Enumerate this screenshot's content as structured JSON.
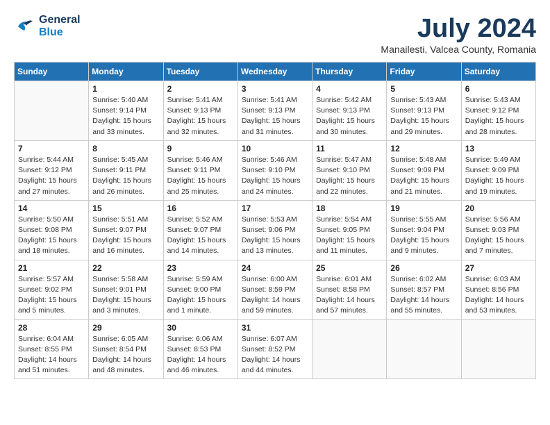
{
  "header": {
    "logo_line1": "General",
    "logo_line2": "Blue",
    "month_title": "July 2024",
    "location": "Manailesti, Valcea County, Romania"
  },
  "days_of_week": [
    "Sunday",
    "Monday",
    "Tuesday",
    "Wednesday",
    "Thursday",
    "Friday",
    "Saturday"
  ],
  "weeks": [
    [
      {
        "day": "",
        "data": ""
      },
      {
        "day": "1",
        "data": "Sunrise: 5:40 AM\nSunset: 9:14 PM\nDaylight: 15 hours\nand 33 minutes."
      },
      {
        "day": "2",
        "data": "Sunrise: 5:41 AM\nSunset: 9:13 PM\nDaylight: 15 hours\nand 32 minutes."
      },
      {
        "day": "3",
        "data": "Sunrise: 5:41 AM\nSunset: 9:13 PM\nDaylight: 15 hours\nand 31 minutes."
      },
      {
        "day": "4",
        "data": "Sunrise: 5:42 AM\nSunset: 9:13 PM\nDaylight: 15 hours\nand 30 minutes."
      },
      {
        "day": "5",
        "data": "Sunrise: 5:43 AM\nSunset: 9:13 PM\nDaylight: 15 hours\nand 29 minutes."
      },
      {
        "day": "6",
        "data": "Sunrise: 5:43 AM\nSunset: 9:12 PM\nDaylight: 15 hours\nand 28 minutes."
      }
    ],
    [
      {
        "day": "7",
        "data": "Sunrise: 5:44 AM\nSunset: 9:12 PM\nDaylight: 15 hours\nand 27 minutes."
      },
      {
        "day": "8",
        "data": "Sunrise: 5:45 AM\nSunset: 9:11 PM\nDaylight: 15 hours\nand 26 minutes."
      },
      {
        "day": "9",
        "data": "Sunrise: 5:46 AM\nSunset: 9:11 PM\nDaylight: 15 hours\nand 25 minutes."
      },
      {
        "day": "10",
        "data": "Sunrise: 5:46 AM\nSunset: 9:10 PM\nDaylight: 15 hours\nand 24 minutes."
      },
      {
        "day": "11",
        "data": "Sunrise: 5:47 AM\nSunset: 9:10 PM\nDaylight: 15 hours\nand 22 minutes."
      },
      {
        "day": "12",
        "data": "Sunrise: 5:48 AM\nSunset: 9:09 PM\nDaylight: 15 hours\nand 21 minutes."
      },
      {
        "day": "13",
        "data": "Sunrise: 5:49 AM\nSunset: 9:09 PM\nDaylight: 15 hours\nand 19 minutes."
      }
    ],
    [
      {
        "day": "14",
        "data": "Sunrise: 5:50 AM\nSunset: 9:08 PM\nDaylight: 15 hours\nand 18 minutes."
      },
      {
        "day": "15",
        "data": "Sunrise: 5:51 AM\nSunset: 9:07 PM\nDaylight: 15 hours\nand 16 minutes."
      },
      {
        "day": "16",
        "data": "Sunrise: 5:52 AM\nSunset: 9:07 PM\nDaylight: 15 hours\nand 14 minutes."
      },
      {
        "day": "17",
        "data": "Sunrise: 5:53 AM\nSunset: 9:06 PM\nDaylight: 15 hours\nand 13 minutes."
      },
      {
        "day": "18",
        "data": "Sunrise: 5:54 AM\nSunset: 9:05 PM\nDaylight: 15 hours\nand 11 minutes."
      },
      {
        "day": "19",
        "data": "Sunrise: 5:55 AM\nSunset: 9:04 PM\nDaylight: 15 hours\nand 9 minutes."
      },
      {
        "day": "20",
        "data": "Sunrise: 5:56 AM\nSunset: 9:03 PM\nDaylight: 15 hours\nand 7 minutes."
      }
    ],
    [
      {
        "day": "21",
        "data": "Sunrise: 5:57 AM\nSunset: 9:02 PM\nDaylight: 15 hours\nand 5 minutes."
      },
      {
        "day": "22",
        "data": "Sunrise: 5:58 AM\nSunset: 9:01 PM\nDaylight: 15 hours\nand 3 minutes."
      },
      {
        "day": "23",
        "data": "Sunrise: 5:59 AM\nSunset: 9:00 PM\nDaylight: 15 hours\nand 1 minute."
      },
      {
        "day": "24",
        "data": "Sunrise: 6:00 AM\nSunset: 8:59 PM\nDaylight: 14 hours\nand 59 minutes."
      },
      {
        "day": "25",
        "data": "Sunrise: 6:01 AM\nSunset: 8:58 PM\nDaylight: 14 hours\nand 57 minutes."
      },
      {
        "day": "26",
        "data": "Sunrise: 6:02 AM\nSunset: 8:57 PM\nDaylight: 14 hours\nand 55 minutes."
      },
      {
        "day": "27",
        "data": "Sunrise: 6:03 AM\nSunset: 8:56 PM\nDaylight: 14 hours\nand 53 minutes."
      }
    ],
    [
      {
        "day": "28",
        "data": "Sunrise: 6:04 AM\nSunset: 8:55 PM\nDaylight: 14 hours\nand 51 minutes."
      },
      {
        "day": "29",
        "data": "Sunrise: 6:05 AM\nSunset: 8:54 PM\nDaylight: 14 hours\nand 48 minutes."
      },
      {
        "day": "30",
        "data": "Sunrise: 6:06 AM\nSunset: 8:53 PM\nDaylight: 14 hours\nand 46 minutes."
      },
      {
        "day": "31",
        "data": "Sunrise: 6:07 AM\nSunset: 8:52 PM\nDaylight: 14 hours\nand 44 minutes."
      },
      {
        "day": "",
        "data": ""
      },
      {
        "day": "",
        "data": ""
      },
      {
        "day": "",
        "data": ""
      }
    ]
  ]
}
